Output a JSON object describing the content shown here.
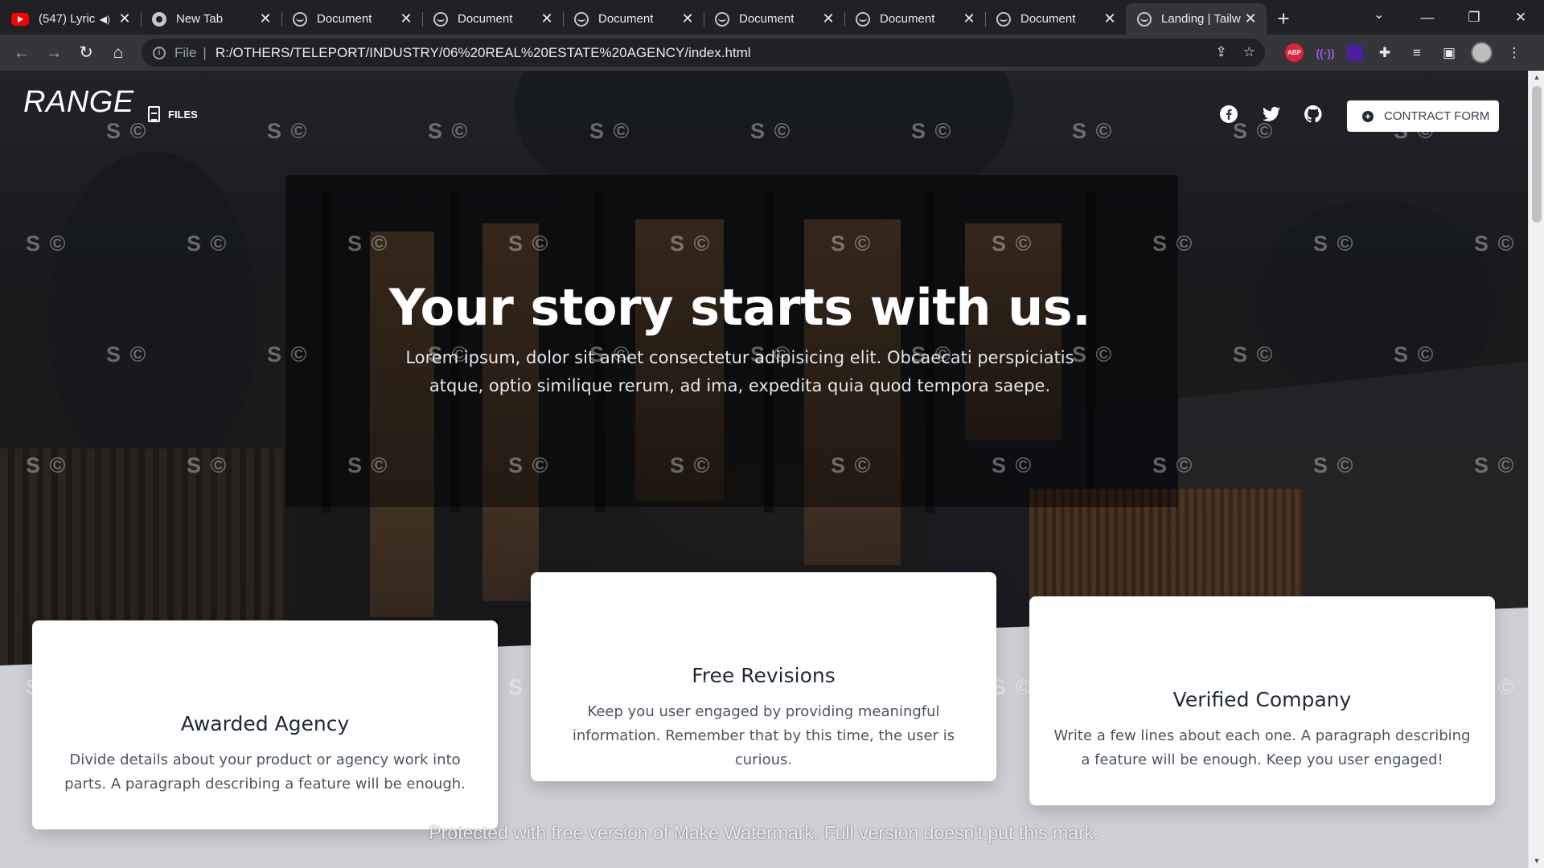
{
  "browser": {
    "tabs": [
      {
        "title": "(547) Lyric",
        "favicon": "youtube-icon",
        "audio": true
      },
      {
        "title": "New Tab",
        "favicon": "chrome-icon",
        "audio": false
      },
      {
        "title": "Document",
        "favicon": "globe-icon",
        "audio": false
      },
      {
        "title": "Document",
        "favicon": "globe-icon",
        "audio": false
      },
      {
        "title": "Document",
        "favicon": "globe-icon",
        "audio": false
      },
      {
        "title": "Document",
        "favicon": "globe-icon",
        "audio": false
      },
      {
        "title": "Document",
        "favicon": "globe-icon",
        "audio": false
      },
      {
        "title": "Document",
        "favicon": "globe-icon",
        "audio": false
      },
      {
        "title": "Landing | Tailw",
        "favicon": "globe-icon",
        "audio": false,
        "active": true
      }
    ],
    "address": {
      "scheme": "File",
      "separator": "|",
      "url": "R:/OTHERS/TELEPORT/INDUSTRY/06%20REAL%20ESTATE%20AGENCY/index.html"
    },
    "extensions": [
      "adblock-plus-icon",
      "radio-icon",
      "purple-extension-icon",
      "puzzle-icon",
      "media-control-icon",
      "side-panel-icon",
      "profile-avatar"
    ],
    "extension_labels": {
      "abp": "ABP",
      "radio": "((·))"
    }
  },
  "site": {
    "logo": "RANGE",
    "nav": {
      "files_label": "FILES"
    },
    "social": [
      "facebook-icon",
      "twitter-icon",
      "github-icon"
    ],
    "contract_button": "CONTRACT FORM",
    "hero": {
      "title": "Your story starts with us.",
      "subtitle": "Lorem ipsum, dolor sit amet consectetur adipisicing elit. Obcaecati perspiciatis atque, optio similique rerum, ad ima, expedita quia quod tempora saepe."
    },
    "features": [
      {
        "title": "Awarded Agency",
        "text": "Divide details about your product or agency work into parts. A paragraph describing a feature will be enough.",
        "icon": "award-icon",
        "color": "#f87171"
      },
      {
        "title": "Free Revisions",
        "text": "Keep you user engaged by providing meaningful information. Remember that by this time, the user is curious.",
        "icon": "retweet-icon",
        "color": "#60a5fa"
      },
      {
        "title": "Verified Company",
        "text": "Write a few lines about each one. A paragraph describing a feature will be enough. Keep you user engaged!",
        "icon": "fingerprint-icon",
        "color": "#34d399"
      }
    ]
  },
  "watermark": {
    "mark": "S ©",
    "banner": "Protected with free version of Make Watermark. Full version doesn't put this mark."
  }
}
